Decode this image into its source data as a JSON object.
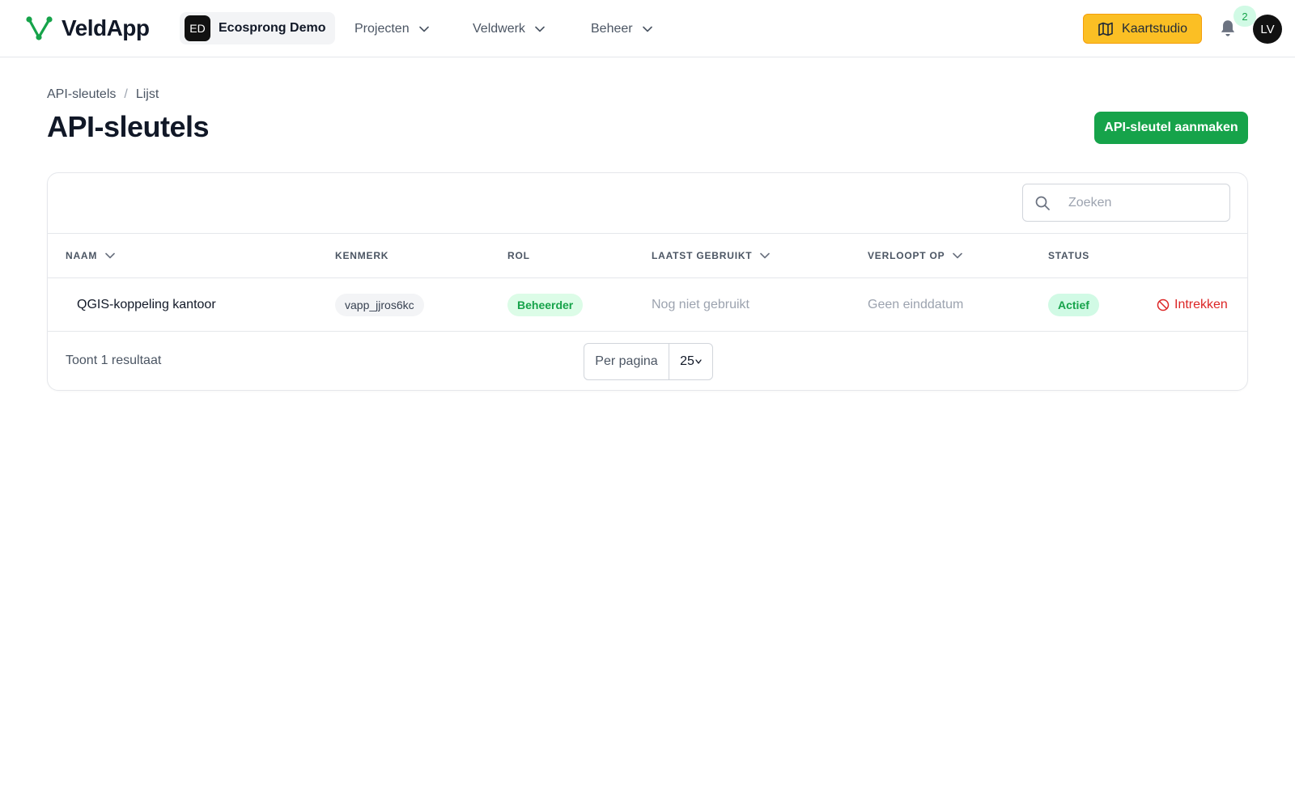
{
  "app": {
    "name": "VeldApp",
    "logo_icon": "veldapp-logo-icon",
    "brand_color": "#16a34a"
  },
  "org": {
    "initials": "ED",
    "name": "Ecosprong Demo"
  },
  "nav": {
    "items": [
      {
        "label": "Projecten"
      },
      {
        "label": "Veldwerk"
      },
      {
        "label": "Beheer"
      }
    ]
  },
  "header_actions": {
    "studio_label": "Kaartstudio",
    "studio_color": "#fbbf24",
    "notification_count": "2",
    "user_initials": "LV"
  },
  "breadcrumb": {
    "items": [
      "API-sleutels",
      "Lijst"
    ],
    "separator": "/"
  },
  "page": {
    "title": "API-sleutels",
    "create_label": "API-sleutel aanmaken"
  },
  "search": {
    "placeholder": "Zoeken",
    "value": ""
  },
  "table": {
    "columns": [
      "NAAM",
      "KENMERK",
      "ROL",
      "LAATST GEBRUIKT",
      "VERLOOPT OP",
      "STATUS"
    ],
    "rows": [
      {
        "name": "QGIS-koppeling kantoor",
        "token": "vapp_jjros6kc",
        "role": "Beheerder",
        "last_used": "Nog niet gebruikt",
        "expires": "Geen einddatum",
        "status": "Actief",
        "action": "Intrekken"
      }
    ]
  },
  "footer": {
    "result_text": "Toont 1 resultaat",
    "per_page_label": "Per pagina",
    "per_page_value": "25"
  }
}
